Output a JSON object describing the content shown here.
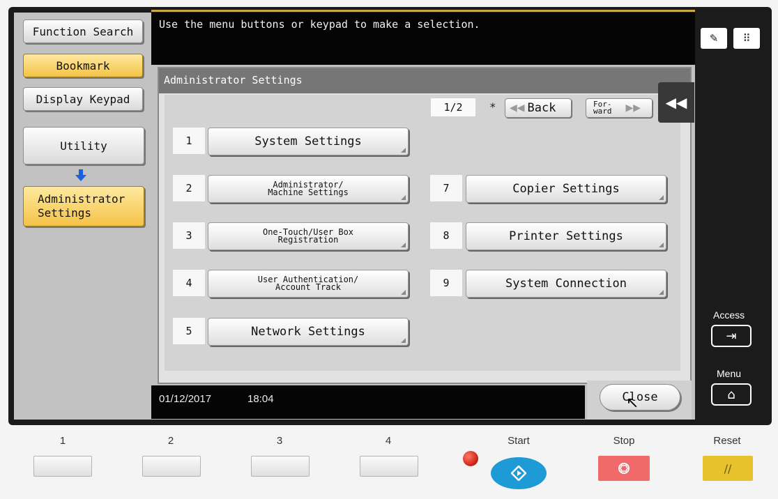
{
  "left_panel": {
    "function_search": "Function Search",
    "bookmark": "Bookmark",
    "display_keypad": "Display Keypad",
    "utility": "Utility",
    "admin_settings_line1": "Administrator",
    "admin_settings_line2": "Settings"
  },
  "message": "Use the menu buttons or keypad to make a selection.",
  "panel": {
    "title": "Administrator Settings",
    "page": "1/2",
    "star": "*",
    "back": "Back",
    "forward_line1": "For-",
    "forward_line2": "ward",
    "items": [
      {
        "num": "1",
        "label": "System Settings"
      },
      {
        "num": "2",
        "label_line1": "Administrator/",
        "label_line2": "Machine Settings"
      },
      {
        "num": "3",
        "label_line1": "One-Touch/User Box",
        "label_line2": "Registration"
      },
      {
        "num": "4",
        "label_line1": "User Authentication/",
        "label_line2": "Account Track"
      },
      {
        "num": "5",
        "label": "Network Settings"
      },
      {
        "num": "7",
        "label": "Copier Settings"
      },
      {
        "num": "8",
        "label": "Printer Settings"
      },
      {
        "num": "9",
        "label": "System Connection"
      }
    ]
  },
  "status": {
    "date": "01/12/2017",
    "time": "18:04",
    "close": "Close"
  },
  "right_panel": {
    "access": "Access",
    "menu": "Menu"
  },
  "hardware": {
    "keys": [
      "1",
      "2",
      "3",
      "4"
    ],
    "start": "Start",
    "stop": "Stop",
    "reset": "Reset"
  },
  "colors": {
    "bookmark_gold": "#f4c346",
    "start_button": "#1e9bd7",
    "stop_button": "#f06a6a",
    "reset_button": "#e8c22c",
    "indicator_red": "#d42a1a"
  }
}
